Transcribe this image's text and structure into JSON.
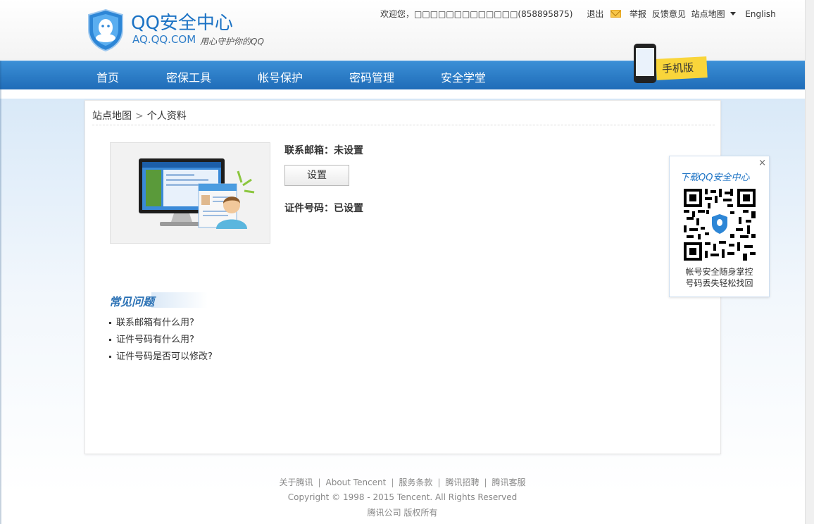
{
  "header": {
    "logo_title": "QQ安全中心",
    "logo_domain": "AQ.QQ.COM",
    "logo_slogan": "用心守护你的QQ",
    "welcome": "欢迎您，",
    "account": "□□□□□□□□□□□□□(858895875)",
    "logout": "退出",
    "report": "举报",
    "feedback": "反馈意见",
    "sitemap": "站点地图",
    "english": "English"
  },
  "nav": {
    "items": [
      "首页",
      "密保工具",
      "帐号保护",
      "密码管理",
      "安全学堂"
    ],
    "mobile_label": "手机版"
  },
  "breadcrumb": {
    "root": "站点地图",
    "separator": ">",
    "current": "个人资料"
  },
  "profile": {
    "email_label": "联系邮箱：",
    "email_status": "未设置",
    "set_button": "设置",
    "id_label": "证件号码：",
    "id_status": "已设置"
  },
  "faq": {
    "title": "常见问题",
    "items": [
      "联系邮箱有什么用?",
      "证件号码有什么用?",
      "证件号码是否可以修改?"
    ]
  },
  "qr_popup": {
    "close": "×",
    "title": "下载QQ安全中心",
    "caption_line1": "帐号安全随身掌控",
    "caption_line2": "号码丢失轻松找回"
  },
  "footer": {
    "links": [
      "关于腾讯",
      "About Tencent",
      "服务条款",
      "腾讯招聘",
      "腾讯客服"
    ],
    "separator": "|",
    "copyright": "Copyright © 1998 - 2015 Tencent. All Rights Reserved",
    "owner": "腾讯公司 版权所有"
  },
  "colors": {
    "brand_blue": "#1b72c4",
    "nav_top": "#3b8fd6",
    "nav_bottom": "#1f6cb8",
    "mobile_tag": "#f9d53a"
  }
}
